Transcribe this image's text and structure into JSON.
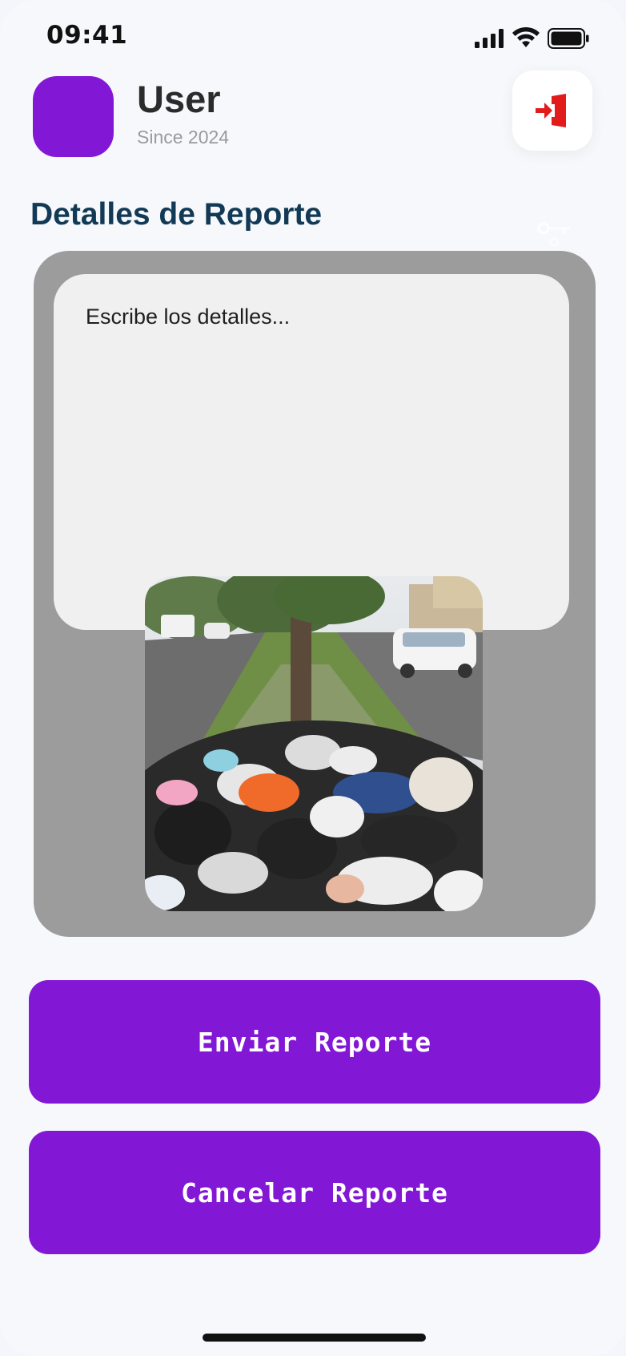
{
  "status_bar": {
    "time": "09:41",
    "icons": [
      "signal-icon",
      "wifi-icon",
      "battery-icon"
    ]
  },
  "header": {
    "user_name": "User",
    "since": "Since 2024",
    "logout_icon": "logout-icon",
    "avatar_color": "#8317d6",
    "logout_color": "#e21b1b"
  },
  "report": {
    "title": "Detalles de Reporte",
    "details_placeholder": "Escribe los detalles...",
    "photo_alt": "Basura acumulada en camellón"
  },
  "actions": {
    "send_label": "Enviar Reporte",
    "cancel_label": "Cancelar Reporte"
  },
  "colors": {
    "accent": "#8317d6",
    "title": "#123a56",
    "card": "#9c9c9c",
    "input": "#f0f0f0"
  }
}
